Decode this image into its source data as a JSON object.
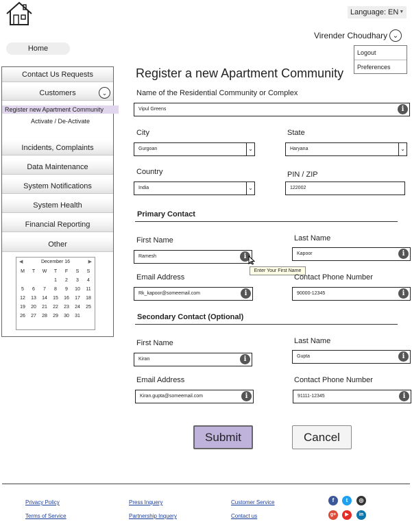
{
  "header": {
    "logo_icon": "house-icon",
    "language_label": "Language: EN",
    "user_name": "Virender Choudhary",
    "user_menu": [
      "Logout",
      "Preferences"
    ],
    "home_label": "Home"
  },
  "sidebar": {
    "items": [
      {
        "label": "Contact Us Requests"
      },
      {
        "label": "Customers"
      },
      {
        "label": "Incidents, Complaints"
      },
      {
        "label": "Data Maintenance"
      },
      {
        "label": "System Notifications"
      },
      {
        "label": "System Health"
      },
      {
        "label": "Financial Reporting"
      },
      {
        "label": "Other"
      }
    ],
    "customers_sub": [
      "Register new Apartment Community",
      "Activate / De-Activate"
    ],
    "calendar": {
      "month": "December 16",
      "weekdays": [
        "M",
        "T",
        "W",
        "T",
        "F",
        "S",
        "S"
      ],
      "weeks": [
        [
          "",
          "",
          "",
          "1",
          "2",
          "3",
          "4"
        ],
        [
          "5",
          "6",
          "7",
          "8",
          "9",
          "10",
          "11"
        ],
        [
          "12",
          "13",
          "14",
          "15",
          "16",
          "17",
          "18"
        ],
        [
          "19",
          "20",
          "21",
          "22",
          "23",
          "24",
          "25"
        ],
        [
          "26",
          "27",
          "28",
          "29",
          "30",
          "31",
          ""
        ]
      ]
    }
  },
  "form": {
    "title": "Register a new Apartment Community",
    "community_label": "Name of the Residential Community or Complex",
    "community_value": "Vipul Greens",
    "city_label": "City",
    "city_value": "Gurgoan",
    "state_label": "State",
    "state_value": "Haryana",
    "country_label": "Country",
    "country_value": "India",
    "pin_label": "PIN / ZIP",
    "pin_value": "122002",
    "primary": {
      "heading": "Primary Contact",
      "first_name_label": "First Name",
      "first_name_value": "Ramesh",
      "last_name_label": "Last Name",
      "last_name_value": "Kapoor",
      "email_label": "Email Address",
      "email_value": "Rk_kapoor@someemail.com",
      "phone_label": "Contact Phone Number",
      "phone_value": "90000-12345",
      "tooltip": "Enter Your First Name"
    },
    "secondary": {
      "heading": "Secondary Contact (Optional)",
      "first_name_label": "First Name",
      "first_name_value": "Kiran",
      "last_name_label": "Last Name",
      "last_name_value": "Gupta",
      "email_label": "Email Address",
      "email_value": "Kiran.gupta@someemail.com",
      "phone_label": "Contact Phone Number",
      "phone_value": "91111-12345"
    },
    "submit_label": "Submit",
    "cancel_label": "Cancel"
  },
  "footer": {
    "links": [
      "Privacy Policy",
      "Terms of Service",
      "Press Inquery",
      "Partnership Inquery",
      "Customer Service",
      "Contact us"
    ],
    "social": [
      {
        "icon": "facebook-icon",
        "glyph": "f",
        "color": "#3b5998"
      },
      {
        "icon": "twitter-icon",
        "glyph": "t",
        "color": "#1da1f2"
      },
      {
        "icon": "instagram-icon",
        "glyph": "◎",
        "color": "#333333"
      },
      {
        "icon": "google-plus-icon",
        "glyph": "g+",
        "color": "#dd4b39"
      },
      {
        "icon": "youtube-icon",
        "glyph": "▶",
        "color": "#e52d27"
      },
      {
        "icon": "linkedin-icon",
        "glyph": "in",
        "color": "#0e76a8"
      }
    ]
  }
}
